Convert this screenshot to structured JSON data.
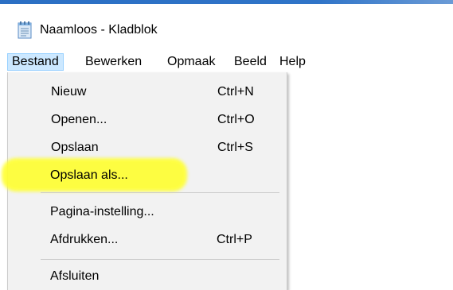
{
  "window": {
    "title": "Naamloos - Kladblok",
    "icon": "notepad-icon"
  },
  "menubar": {
    "items": [
      {
        "label": "Bestand",
        "active": true
      },
      {
        "label": "Bewerken",
        "active": false
      },
      {
        "label": "Opmaak",
        "active": false
      },
      {
        "label": "Beeld",
        "active": false
      },
      {
        "label": "Help",
        "active": false
      }
    ]
  },
  "file_menu": {
    "items": [
      {
        "label": "Nieuw",
        "shortcut": "Ctrl+N"
      },
      {
        "label": "Openen...",
        "shortcut": "Ctrl+O"
      },
      {
        "label": "Opslaan",
        "shortcut": "Ctrl+S"
      },
      {
        "label": "Opslaan als...",
        "shortcut": ""
      },
      {
        "label": "Pagina-instelling...",
        "shortcut": ""
      },
      {
        "label": "Afdrukken...",
        "shortcut": "Ctrl+P"
      },
      {
        "label": "Afsluiten",
        "shortcut": ""
      }
    ],
    "highlighted_item": "Opslaan als...",
    "highlight_color": "#ffff33"
  },
  "colors": {
    "title_accent": "#2b6fc4",
    "menu_active_bg": "#cce8ff",
    "menu_active_border": "#99d1ff",
    "dropdown_bg": "#f2f2f2"
  }
}
